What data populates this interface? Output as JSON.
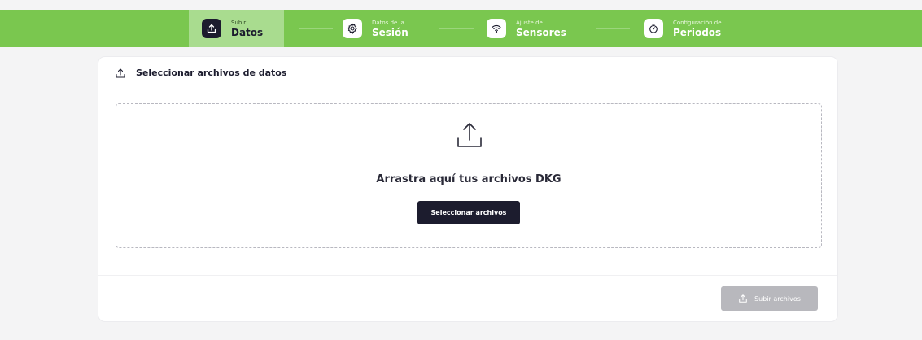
{
  "stepper": {
    "steps": [
      {
        "small": "Subir",
        "big": "Datos",
        "icon": "upload-icon",
        "active": true
      },
      {
        "small": "Datos de la",
        "big": "Sesión",
        "icon": "gear-icon",
        "active": false
      },
      {
        "small": "Ajuste de",
        "big": "Sensores",
        "icon": "wifi-icon",
        "active": false
      },
      {
        "small": "Configuración de",
        "big": "Periodos",
        "icon": "timer-icon",
        "active": false
      }
    ],
    "colors": {
      "bar": "#7ac74f",
      "active": "#a9dc8f",
      "dark": "#1c1c2e"
    }
  },
  "card": {
    "header_title": "Seleccionar archivos de datos",
    "dropzone": {
      "title": "Arrastra aquí tus archivos DKG",
      "button_label": "Seleccionar archivos"
    },
    "upload_button_label": "Subir archivos",
    "upload_button_disabled": true
  }
}
